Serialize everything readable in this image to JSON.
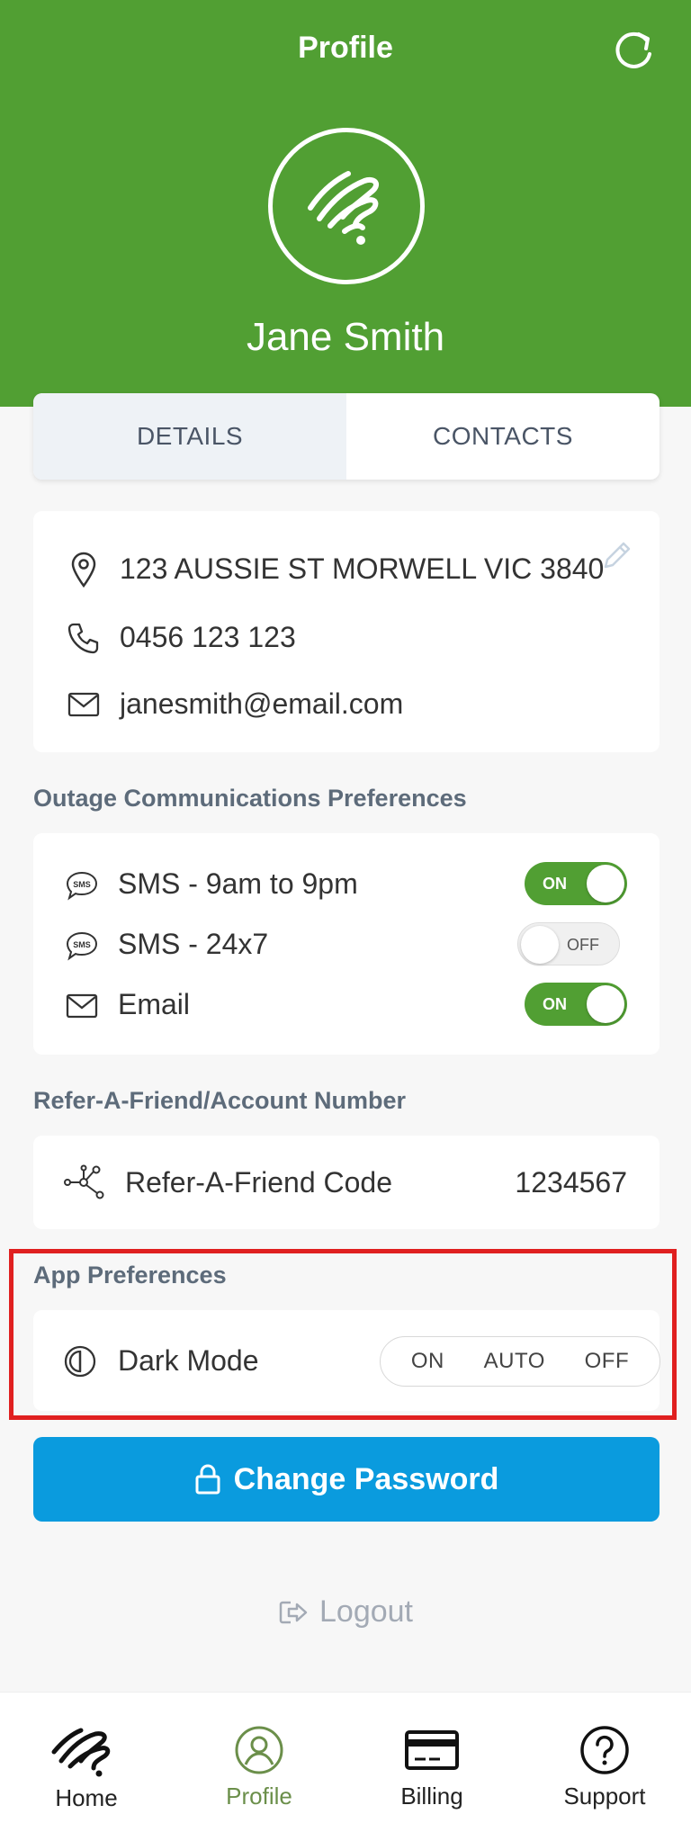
{
  "header": {
    "title": "Profile",
    "user_name": "Jane Smith"
  },
  "tabs": [
    {
      "label": "DETAILS",
      "active": true
    },
    {
      "label": "CONTACTS",
      "active": false
    }
  ],
  "details": {
    "address": "123 AUSSIE ST MORWELL VIC 3840",
    "phone": "0456 123 123",
    "email": "janesmith@email.com"
  },
  "outage": {
    "title": "Outage Communications Preferences",
    "items": [
      {
        "label": "SMS - 9am to 9pm",
        "state_label": "ON",
        "on": true,
        "icon": "sms-icon"
      },
      {
        "label": "SMS - 24x7",
        "state_label": "OFF",
        "on": false,
        "icon": "sms-icon"
      },
      {
        "label": "Email",
        "state_label": "ON",
        "on": true,
        "icon": "email-icon"
      }
    ]
  },
  "refer": {
    "title": "Refer-A-Friend/Account Number",
    "label": "Refer-A-Friend Code",
    "code": "1234567"
  },
  "app_prefs": {
    "title": "App Preferences",
    "dark_mode_label": "Dark Mode",
    "options": [
      "ON",
      "AUTO",
      "OFF"
    ]
  },
  "change_password_label": "Change Password",
  "logout_label": "Logout",
  "nav": [
    {
      "label": "Home",
      "icon": "home-logo-icon"
    },
    {
      "label": "Profile",
      "icon": "profile-icon",
      "active": true
    },
    {
      "label": "Billing",
      "icon": "card-icon"
    },
    {
      "label": "Support",
      "icon": "help-icon"
    }
  ],
  "colors": {
    "brand_green": "#519f33",
    "primary_blue": "#0a9bde",
    "highlight_red": "#e02020"
  }
}
